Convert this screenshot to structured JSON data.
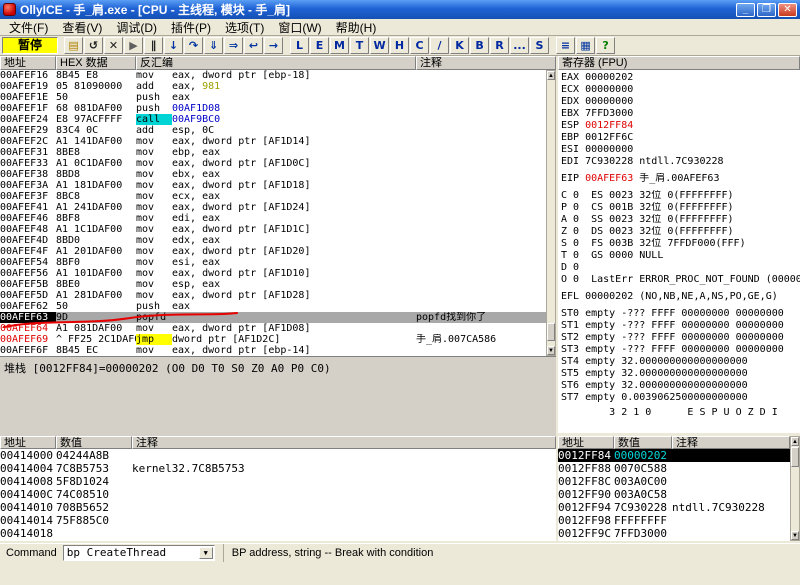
{
  "window": {
    "title": "OllyICE - 手_肩.exe - [CPU - 主线程, 模块 - 手_肩]"
  },
  "menu": {
    "items": [
      "文件(F)",
      "查看(V)",
      "调试(D)",
      "插件(P)",
      "选项(T)",
      "窗口(W)",
      "帮助(H)"
    ]
  },
  "toolbar": {
    "status": "暂停",
    "icon_buttons": [
      {
        "name": "open-file",
        "glyph": "▤",
        "color": "#B08000"
      },
      {
        "name": "restart",
        "glyph": "↺",
        "color": "#202020"
      },
      {
        "name": "close-process",
        "glyph": "✕",
        "color": "#202020"
      },
      {
        "name": "run",
        "glyph": "▶",
        "color": "#606060"
      },
      {
        "name": "pause",
        "glyph": "∥",
        "color": "#202020"
      },
      {
        "name": "step-into",
        "glyph": "↓",
        "color": "#0033A0"
      },
      {
        "name": "step-over",
        "glyph": "↷",
        "color": "#0033A0"
      },
      {
        "name": "animate-into",
        "glyph": "⇓",
        "color": "#0033A0"
      },
      {
        "name": "animate-over",
        "glyph": "⇒",
        "color": "#0033A0"
      },
      {
        "name": "execute-till-return",
        "glyph": "↩",
        "color": "#0033A0"
      },
      {
        "name": "go-to-address",
        "glyph": "→",
        "color": "#0033A0"
      }
    ],
    "letter_buttons": [
      "L",
      "E",
      "M",
      "T",
      "W",
      "H",
      "C",
      "/",
      "K",
      "B",
      "R",
      "...",
      "S"
    ],
    "tail_buttons": [
      {
        "name": "appearance",
        "glyph": "≡",
        "color": "#0033A0"
      },
      {
        "name": "windows-list",
        "glyph": "▦",
        "color": "#0033A0"
      },
      {
        "name": "help",
        "glyph": "?",
        "color": "#008000"
      }
    ]
  },
  "disasm": {
    "headers": [
      "地址",
      "HEX 数据",
      "反汇编",
      "注释"
    ],
    "rows": [
      {
        "addr": "00AFEF16",
        "hex": "8B45 E8",
        "mn": "mov",
        "op": [
          {
            "t": "eax, dword ptr [ebp-18]"
          }
        ]
      },
      {
        "addr": "00AFEF19",
        "hex": "05 81090000",
        "mn": "add",
        "op": [
          {
            "t": "eax, "
          },
          {
            "t": "981",
            "c": "#9E9E00"
          }
        ]
      },
      {
        "addr": "00AFEF1E",
        "hex": "50",
        "mn": "push",
        "op": [
          {
            "t": "eax"
          }
        ]
      },
      {
        "addr": "00AFEF1F",
        "hex": "68 081DAF00",
        "mn": "push",
        "op": [
          {
            "t": "00AF1D08",
            "c": "#0000C8"
          }
        ]
      },
      {
        "addr": "00AFEF24",
        "hex": "E8 97ACFFFF",
        "mn": "call",
        "mn_hl": "cyan",
        "op": [
          {
            "t": "00AF9BC0",
            "c": "#0000C8"
          }
        ]
      },
      {
        "addr": "00AFEF29",
        "hex": "83C4 0C",
        "mn": "add",
        "op": [
          {
            "t": "esp, 0C"
          }
        ]
      },
      {
        "addr": "00AFEF2C",
        "hex": "A1 141DAF00",
        "mn": "mov",
        "op": [
          {
            "t": "eax, dword ptr [AF1D14]"
          }
        ]
      },
      {
        "addr": "00AFEF31",
        "hex": "8BE8",
        "mn": "mov",
        "op": [
          {
            "t": "ebp, eax"
          }
        ]
      },
      {
        "addr": "00AFEF33",
        "hex": "A1 0C1DAF00",
        "mn": "mov",
        "op": [
          {
            "t": "eax, dword ptr [AF1D0C]"
          }
        ]
      },
      {
        "addr": "00AFEF38",
        "hex": "8BD8",
        "mn": "mov",
        "op": [
          {
            "t": "ebx, eax"
          }
        ]
      },
      {
        "addr": "00AFEF3A",
        "hex": "A1 181DAF00",
        "mn": "mov",
        "op": [
          {
            "t": "eax, dword ptr [AF1D18]"
          }
        ]
      },
      {
        "addr": "00AFEF3F",
        "hex": "8BC8",
        "mn": "mov",
        "op": [
          {
            "t": "ecx, eax"
          }
        ]
      },
      {
        "addr": "00AFEF41",
        "hex": "A1 241DAF00",
        "mn": "mov",
        "op": [
          {
            "t": "eax, dword ptr [AF1D24]"
          }
        ]
      },
      {
        "addr": "00AFEF46",
        "hex": "8BF8",
        "mn": "mov",
        "op": [
          {
            "t": "edi, eax"
          }
        ]
      },
      {
        "addr": "00AFEF48",
        "hex": "A1 1C1DAF00",
        "mn": "mov",
        "op": [
          {
            "t": "eax, dword ptr [AF1D1C]"
          }
        ]
      },
      {
        "addr": "00AFEF4D",
        "hex": "8BD0",
        "mn": "mov",
        "op": [
          {
            "t": "edx, eax"
          }
        ]
      },
      {
        "addr": "00AFEF4F",
        "hex": "A1 201DAF00",
        "mn": "mov",
        "op": [
          {
            "t": "eax, dword ptr [AF1D20]"
          }
        ]
      },
      {
        "addr": "00AFEF54",
        "hex": "8BF0",
        "mn": "mov",
        "op": [
          {
            "t": "esi, eax"
          }
        ]
      },
      {
        "addr": "00AFEF56",
        "hex": "A1 101DAF00",
        "mn": "mov",
        "op": [
          {
            "t": "eax, dword ptr [AF1D10]"
          }
        ]
      },
      {
        "addr": "00AFEF5B",
        "hex": "8BE0",
        "mn": "mov",
        "op": [
          {
            "t": "esp, eax"
          }
        ]
      },
      {
        "addr": "00AFEF5D",
        "hex": "A1 281DAF00",
        "mn": "mov",
        "op": [
          {
            "t": "eax, dword ptr [AF1D28]"
          }
        ]
      },
      {
        "addr": "00AFEF62",
        "hex": "50",
        "mn": "push",
        "op": [
          {
            "t": "eax"
          }
        ]
      },
      {
        "addr": "00AFEF63",
        "hex": "9D",
        "mn": "popfd",
        "op": [],
        "comment": "popfd找到你了",
        "sel": true
      },
      {
        "addr": "00AFEF64",
        "hex": "A1 081DAF00",
        "mn": "mov",
        "op": [
          {
            "t": "eax, dword ptr [AF1D08]"
          }
        ],
        "red_addr": true
      },
      {
        "addr": "00AFEF69",
        "hex": "^ FF25 2C1DAF00",
        "mn": "jmp",
        "mn_hl": "yellow",
        "op": [
          {
            "t": "dword ptr [AF1D2C]"
          }
        ],
        "comment": "手_肩.007CA586",
        "red_addr": true
      },
      {
        "addr": "00AFEF6F",
        "hex": "8B45 EC",
        "mn": "mov",
        "op": [
          {
            "t": "eax, dword ptr [ebp-14]"
          }
        ]
      }
    ]
  },
  "info_pane": {
    "text": "堆栈 [0012FF84]=00000202 (O0 D0 T0 S0 Z0 A0 P0 C0)"
  },
  "registers": {
    "title": "寄存器 (FPU)",
    "gpr": [
      {
        "name": "EAX",
        "value": "00000202"
      },
      {
        "name": "ECX",
        "value": "00000000"
      },
      {
        "name": "EDX",
        "value": "00000000"
      },
      {
        "name": "EBX",
        "value": "7FFD3000"
      },
      {
        "name": "ESP",
        "value": "0012FF84",
        "red": true
      },
      {
        "name": "EBP",
        "value": "0012FF6C"
      },
      {
        "name": "ESI",
        "value": "00000000"
      },
      {
        "name": "EDI",
        "value": "7C930228",
        "extra": "ntdll.7C930228"
      }
    ],
    "eip": {
      "name": "EIP",
      "value": "00AFEF63",
      "extra": "手_肩.00AFEF63",
      "red": true
    },
    "flags": [
      "C 0  ES 0023 32位 0(FFFFFFFF)",
      "P 0  CS 001B 32位 0(FFFFFFFF)",
      "A 0  SS 0023 32位 0(FFFFFFFF)",
      "Z 0  DS 0023 32位 0(FFFFFFFF)",
      "S 0  FS 003B 32位 7FFDF000(FFF)",
      "T 0  GS 0000 NULL",
      "D 0",
      "O 0  LastErr ERROR_PROC_NOT_FOUND (0000007F)"
    ],
    "efl": "EFL 00000202 (NO,NB,NE,A,NS,PO,GE,G)",
    "fpu": [
      "ST0 empty -??? FFFF 00000000 00000000",
      "ST1 empty -??? FFFF 00000000 00000000",
      "ST2 empty -??? FFFF 00000000 00000000",
      "ST3 empty -??? FFFF 00000000 00000000",
      "ST4 empty 32.000000000000000000",
      "ST5 empty 32.000000000000000000",
      "ST6 empty 32.000000000000000000",
      "ST7 empty 0.0039062500000000000"
    ],
    "fpu_bits": "        3 2 1 0      E S P U O Z D I"
  },
  "dump": {
    "headers": [
      "地址",
      "数值",
      "注释"
    ],
    "rows": [
      {
        "a": "00414000",
        "v": "04244A8B",
        "c": ""
      },
      {
        "a": "00414004",
        "v": "7C8B5753",
        "c": "kernel32.7C8B5753"
      },
      {
        "a": "00414008",
        "v": "5F8D1024",
        "c": ""
      },
      {
        "a": "0041400C",
        "v": "74C08510",
        "c": ""
      },
      {
        "a": "00414010",
        "v": "708B5652",
        "c": ""
      },
      {
        "a": "00414014",
        "v": "75F885C0",
        "c": ""
      },
      {
        "a": "00414018",
        "v": "",
        "c": ""
      }
    ]
  },
  "stack": {
    "headers": [
      "地址",
      "数值",
      "注释"
    ],
    "rows": [
      {
        "a": "0012FF84",
        "v": "00000202",
        "c": "",
        "sel": true
      },
      {
        "a": "0012FF88",
        "v": "0070C588",
        "c": ""
      },
      {
        "a": "0012FF8C",
        "v": "003A0C00",
        "c": ""
      },
      {
        "a": "0012FF90",
        "v": "003A0C58",
        "c": ""
      },
      {
        "a": "0012FF94",
        "v": "7C930228",
        "c": "ntdll.7C930228"
      },
      {
        "a": "0012FF98",
        "v": "FFFFFFFF",
        "c": ""
      },
      {
        "a": "0012FF9C",
        "v": "7FFD3000",
        "c": ""
      }
    ]
  },
  "command_bar": {
    "label": "Command",
    "value": "bp CreateThread",
    "hint": "BP address, string -- Break with condition"
  }
}
